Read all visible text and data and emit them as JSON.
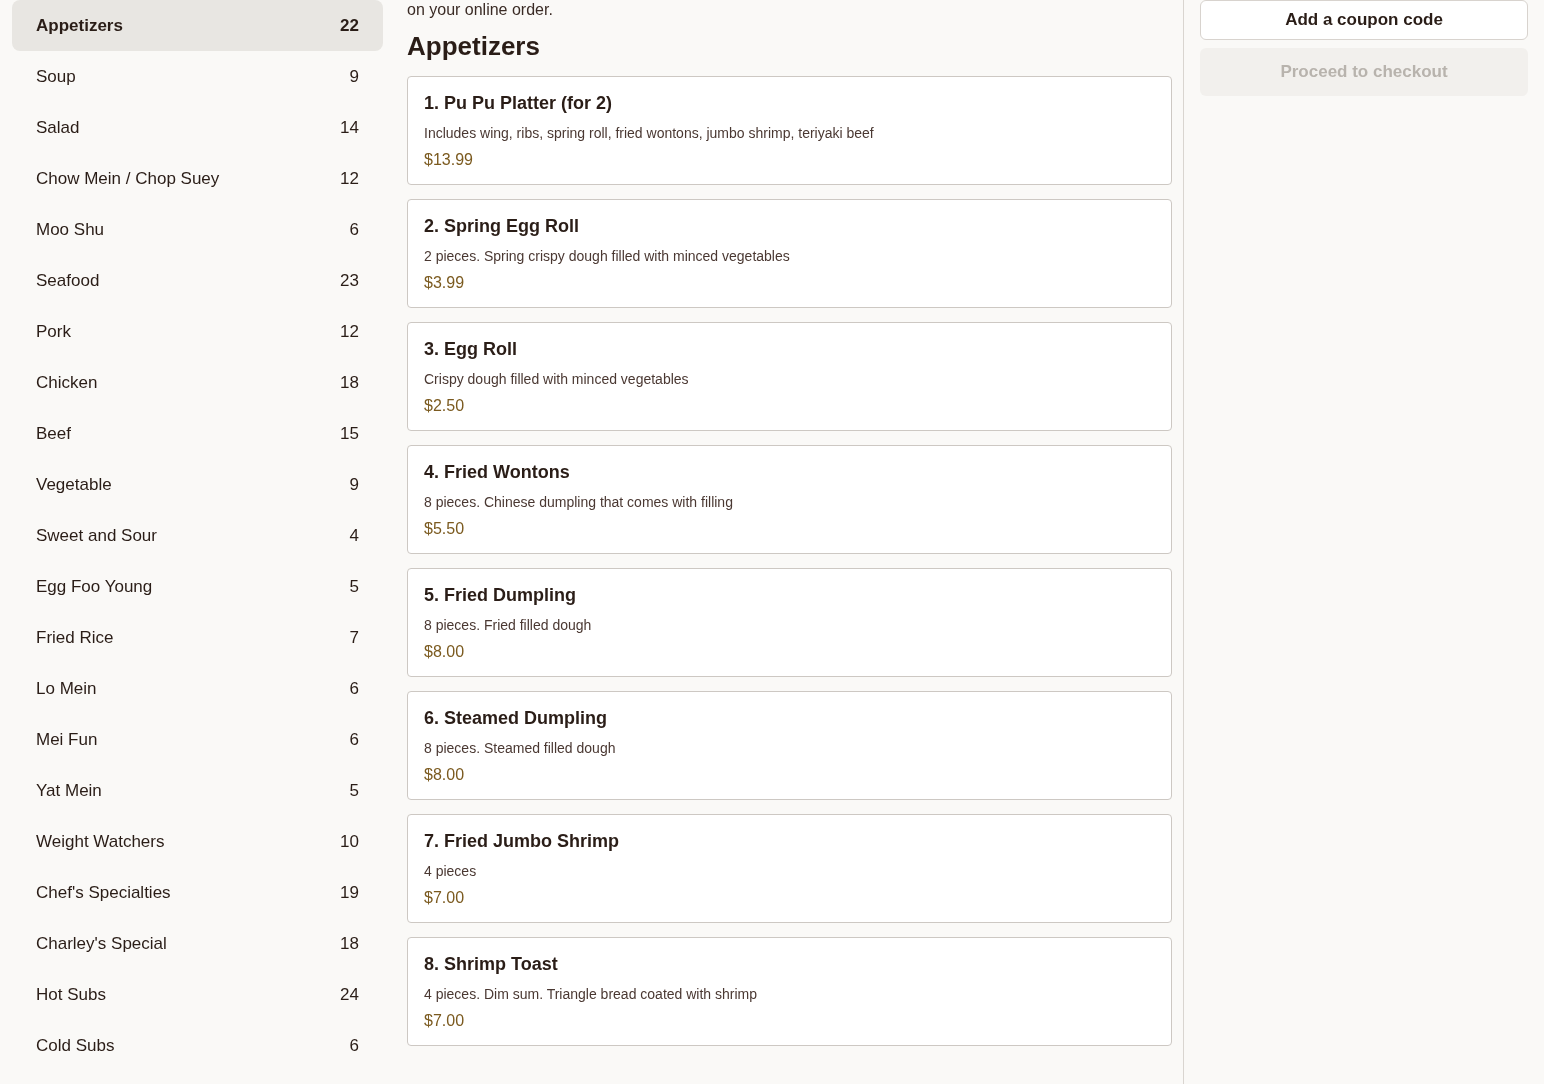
{
  "sidebar": {
    "items": [
      {
        "label": "Appetizers",
        "count": "22",
        "selected": true
      },
      {
        "label": "Soup",
        "count": "9",
        "selected": false
      },
      {
        "label": "Salad",
        "count": "14",
        "selected": false
      },
      {
        "label": "Chow Mein / Chop Suey",
        "count": "12",
        "selected": false
      },
      {
        "label": "Moo Shu",
        "count": "6",
        "selected": false
      },
      {
        "label": "Seafood",
        "count": "23",
        "selected": false
      },
      {
        "label": "Pork",
        "count": "12",
        "selected": false
      },
      {
        "label": "Chicken",
        "count": "18",
        "selected": false
      },
      {
        "label": "Beef",
        "count": "15",
        "selected": false
      },
      {
        "label": "Vegetable",
        "count": "9",
        "selected": false
      },
      {
        "label": "Sweet and Sour",
        "count": "4",
        "selected": false
      },
      {
        "label": "Egg Foo Young",
        "count": "5",
        "selected": false
      },
      {
        "label": "Fried Rice",
        "count": "7",
        "selected": false
      },
      {
        "label": "Lo Mein",
        "count": "6",
        "selected": false
      },
      {
        "label": "Mei Fun",
        "count": "6",
        "selected": false
      },
      {
        "label": "Yat Mein",
        "count": "5",
        "selected": false
      },
      {
        "label": "Weight Watchers",
        "count": "10",
        "selected": false
      },
      {
        "label": "Chef's Specialties",
        "count": "19",
        "selected": false
      },
      {
        "label": "Charley's Special",
        "count": "18",
        "selected": false
      },
      {
        "label": "Hot Subs",
        "count": "24",
        "selected": false
      },
      {
        "label": "Cold Subs",
        "count": "6",
        "selected": false
      }
    ]
  },
  "menu": {
    "intro": "on your online order.",
    "heading": "Appetizers",
    "items": [
      {
        "title": "1. Pu Pu Platter (for 2)",
        "description": "Includes wing, ribs, spring roll, fried wontons, jumbo shrimp, teriyaki beef",
        "price": "$13.99"
      },
      {
        "title": "2. Spring Egg Roll",
        "description": "2 pieces. Spring crispy dough filled with minced vegetables",
        "price": "$3.99"
      },
      {
        "title": "3. Egg Roll",
        "description": "Crispy dough filled with minced vegetables",
        "price": "$2.50"
      },
      {
        "title": "4. Fried Wontons",
        "description": "8 pieces. Chinese dumpling that comes with filling",
        "price": "$5.50"
      },
      {
        "title": "5. Fried Dumpling",
        "description": "8 pieces. Fried filled dough",
        "price": "$8.00"
      },
      {
        "title": "6. Steamed Dumpling",
        "description": "8 pieces. Steamed filled dough",
        "price": "$8.00"
      },
      {
        "title": "7. Fried Jumbo Shrimp",
        "description": "4 pieces",
        "price": "$7.00"
      },
      {
        "title": "8. Shrimp Toast",
        "description": "4 pieces. Dim sum. Triangle bread coated with shrimp",
        "price": "$7.00"
      }
    ]
  },
  "cart": {
    "buttons": [
      {
        "label": "Add a coupon code",
        "disabled": false
      },
      {
        "label": "Proceed to checkout",
        "disabled": true
      }
    ]
  }
}
